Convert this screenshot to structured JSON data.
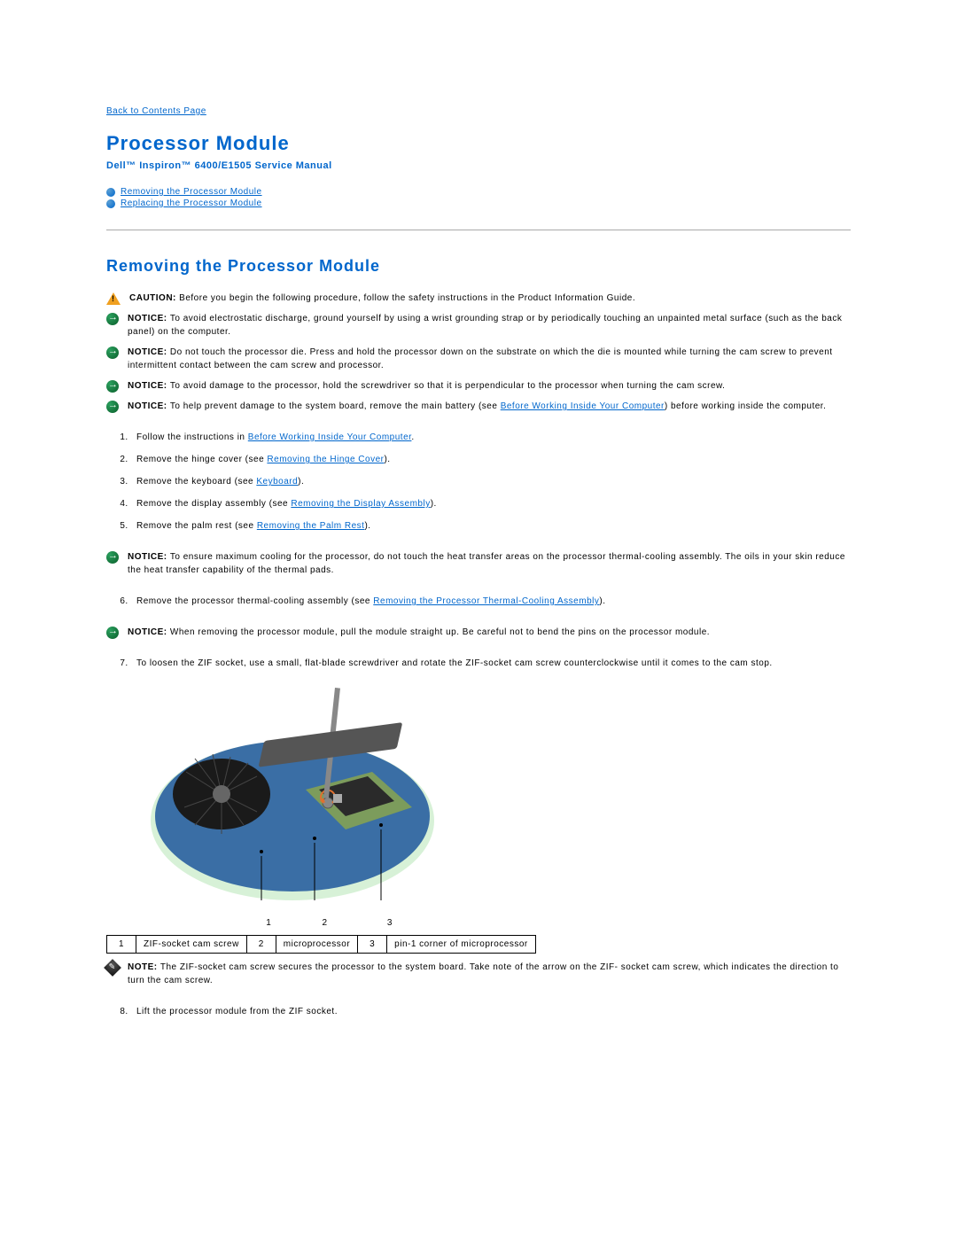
{
  "back_link": "Back to Contents Page",
  "title": "Processor Module",
  "subtitle": "Dell™ Inspiron™ 6400/E1505 Service Manual",
  "toc": [
    "Removing the Processor Module",
    "Replacing the Processor Module"
  ],
  "section_heading": "Removing the Processor Module",
  "alerts": {
    "caution_label": "CAUTION: ",
    "caution_text": "Before you begin the following procedure, follow the safety instructions in the Product Information Guide.",
    "notice_label": "NOTICE: ",
    "n1": "To avoid electrostatic discharge, ground yourself by using a wrist grounding strap or by periodically touching an unpainted metal surface (such as the back panel) on the computer.",
    "n2": "Do not touch the processor die. Press and hold the processor down on the substrate on which the die is mounted while turning the cam screw to prevent intermittent contact between the cam screw and processor.",
    "n3": "To avoid damage to the processor, hold the screwdriver so that it is perpendicular to the processor when turning the cam screw.",
    "n4a": "To help prevent damage to the system board, remove the main battery (see ",
    "n4_link": "Before Working Inside Your Computer",
    "n4b": ") before working inside the computer.",
    "n5": "To ensure maximum cooling for the processor, do not touch the heat transfer areas on the processor thermal-cooling assembly. The oils in your skin reduce the heat transfer capability of the thermal pads.",
    "n6": "When removing the processor module, pull the module straight up. Be careful not to bend the pins on the processor module.",
    "note_label": "NOTE: ",
    "note_text": "The ZIF-socket cam screw secures the processor to the system board. Take note of the arrow on the ZIF- socket cam screw, which indicates the direction to turn the cam screw."
  },
  "steps": {
    "s1a": "Follow the instructions in ",
    "s1_link": "Before Working Inside Your Computer",
    "s1b": ".",
    "s2a": "Remove the hinge cover (see ",
    "s2_link": "Removing the Hinge Cover",
    "s2b": ").",
    "s3a": "Remove the keyboard (see ",
    "s3_link": "Keyboard",
    "s3b": ").",
    "s4a": "Remove the display assembly (see ",
    "s4_link": "Removing the Display Assembly",
    "s4b": ").",
    "s5a": "Remove the palm rest (see ",
    "s5_link": "Removing the Palm Rest",
    "s5b": ").",
    "s6a": "Remove the processor thermal-cooling assembly (see ",
    "s6_link": "Removing the Processor Thermal-Cooling Assembly",
    "s6b": ").",
    "s7": "To loosen the ZIF socket, use a small, flat-blade screwdriver and rotate the ZIF-socket cam screw counterclockwise until it comes to the cam stop.",
    "s8": "Lift the processor module from the ZIF socket."
  },
  "callouts": {
    "c1": "1",
    "c2": "2",
    "c3": "3"
  },
  "legend": {
    "r1n": "1",
    "r1t": "ZIF-socket cam screw",
    "r2n": "2",
    "r2t": "microprocessor",
    "r3n": "3",
    "r3t": "pin-1 corner of microprocessor"
  }
}
